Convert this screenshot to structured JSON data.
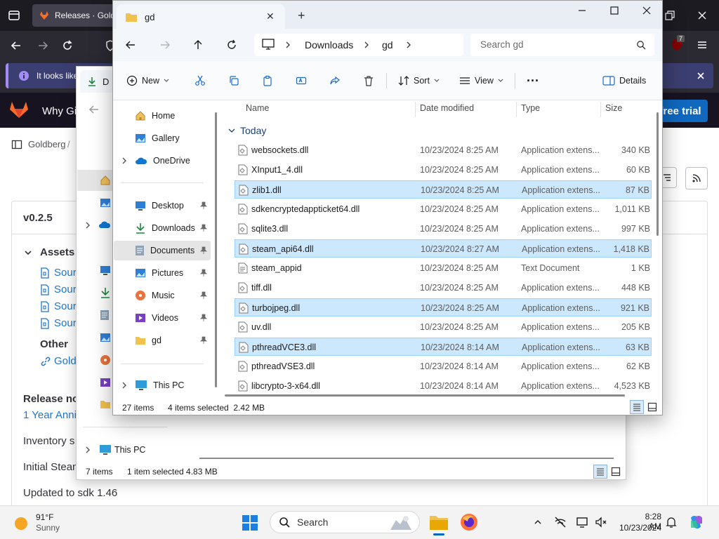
{
  "browser": {
    "tab_title": "Releases · Goldb",
    "notice_text": "It looks like",
    "badge_count": "7",
    "gitlab_header_text": "Why Gi",
    "trial_button": "free trial",
    "breadcrumb": "Goldberg",
    "breadcrumb_sep": "/",
    "new_label": "N",
    "release_version": "v0.2.5",
    "assets_label": "Assets",
    "source_items": [
      "Sour",
      "Sour",
      "Sour",
      "Sour"
    ],
    "other_label": "Other",
    "other_link": "Gold",
    "release_notes_label": "Release no",
    "anniversary_link": "1 Year Anni",
    "inventory_text": "Inventory s",
    "initial_text": "Initial Stean",
    "updated_text": "Updated to sdk 1.46"
  },
  "explorer2": {
    "tab_label": "D",
    "nav_this_pc": "This PC",
    "status_count": "7 items",
    "status_selected": "1 item selected  4.83 MB"
  },
  "explorer1": {
    "tab_title": "gd",
    "tab_close": "✕",
    "new_tab": "+",
    "breadcrumb": [
      "Downloads",
      "gd"
    ],
    "search_placeholder": "Search gd",
    "commands": {
      "new": "New",
      "sort": "Sort",
      "view": "View",
      "more": "···",
      "details": "Details"
    },
    "nav": {
      "home": "Home",
      "gallery": "Gallery",
      "onedrive": "OneDrive",
      "desktop": "Desktop",
      "downloads": "Downloads",
      "documents": "Documents",
      "pictures": "Pictures",
      "music": "Music",
      "videos": "Videos",
      "gd": "gd",
      "this_pc": "This PC"
    },
    "columns": {
      "name": "Name",
      "date": "Date modified",
      "type": "Type",
      "size": "Size"
    },
    "group_label": "Today",
    "files": [
      {
        "name": "websockets.dll",
        "date": "10/23/2024 8:25 AM",
        "type": "Application extens...",
        "size": "340 KB",
        "selected": false,
        "icon": "dll-file-icon"
      },
      {
        "name": "XInput1_4.dll",
        "date": "10/23/2024 8:25 AM",
        "type": "Application extens...",
        "size": "60 KB",
        "selected": false,
        "icon": "dll-file-icon"
      },
      {
        "name": "zlib1.dll",
        "date": "10/23/2024 8:25 AM",
        "type": "Application extens...",
        "size": "87 KB",
        "selected": true,
        "icon": "dll-file-icon"
      },
      {
        "name": "sdkencryptedappticket64.dll",
        "date": "10/23/2024 8:25 AM",
        "type": "Application extens...",
        "size": "1,011 KB",
        "selected": false,
        "icon": "dll-file-icon"
      },
      {
        "name": "sqlite3.dll",
        "date": "10/23/2024 8:25 AM",
        "type": "Application extens...",
        "size": "997 KB",
        "selected": false,
        "icon": "dll-file-icon"
      },
      {
        "name": "steam_api64.dll",
        "date": "10/23/2024 8:27 AM",
        "type": "Application extens...",
        "size": "1,418 KB",
        "selected": true,
        "icon": "dll-file-icon"
      },
      {
        "name": "steam_appid",
        "date": "10/23/2024 8:25 AM",
        "type": "Text Document",
        "size": "1 KB",
        "selected": false,
        "icon": "text-file-icon"
      },
      {
        "name": "tiff.dll",
        "date": "10/23/2024 8:25 AM",
        "type": "Application extens...",
        "size": "448 KB",
        "selected": false,
        "icon": "dll-file-icon"
      },
      {
        "name": "turbojpeg.dll",
        "date": "10/23/2024 8:25 AM",
        "type": "Application extens...",
        "size": "921 KB",
        "selected": true,
        "icon": "dll-file-icon"
      },
      {
        "name": "uv.dll",
        "date": "10/23/2024 8:25 AM",
        "type": "Application extens...",
        "size": "205 KB",
        "selected": false,
        "icon": "dll-file-icon"
      },
      {
        "name": "pthreadVCE3.dll",
        "date": "10/23/2024 8:14 AM",
        "type": "Application extens...",
        "size": "63 KB",
        "selected": true,
        "icon": "dll-file-icon"
      },
      {
        "name": "pthreadVSE3.dll",
        "date": "10/23/2024 8:14 AM",
        "type": "Application extens...",
        "size": "62 KB",
        "selected": false,
        "icon": "dll-file-icon"
      },
      {
        "name": "libcrypto-3-x64.dll",
        "date": "10/23/2024 8:14 AM",
        "type": "Application extens...",
        "size": "4,523 KB",
        "selected": false,
        "icon": "dll-file-icon"
      }
    ],
    "status_count": "27 items",
    "status_selected": "4 items selected  2.42 MB"
  },
  "taskbar": {
    "temperature": "91°F",
    "weather": "Sunny",
    "search_label": "Search",
    "time": "8:28 AM",
    "date": "10/23/2024"
  },
  "colors": {
    "selection": "#cce8ff",
    "accent": "#0067c0",
    "gitlab_dark": "#171321",
    "browser_dark": "#1c1b22"
  }
}
